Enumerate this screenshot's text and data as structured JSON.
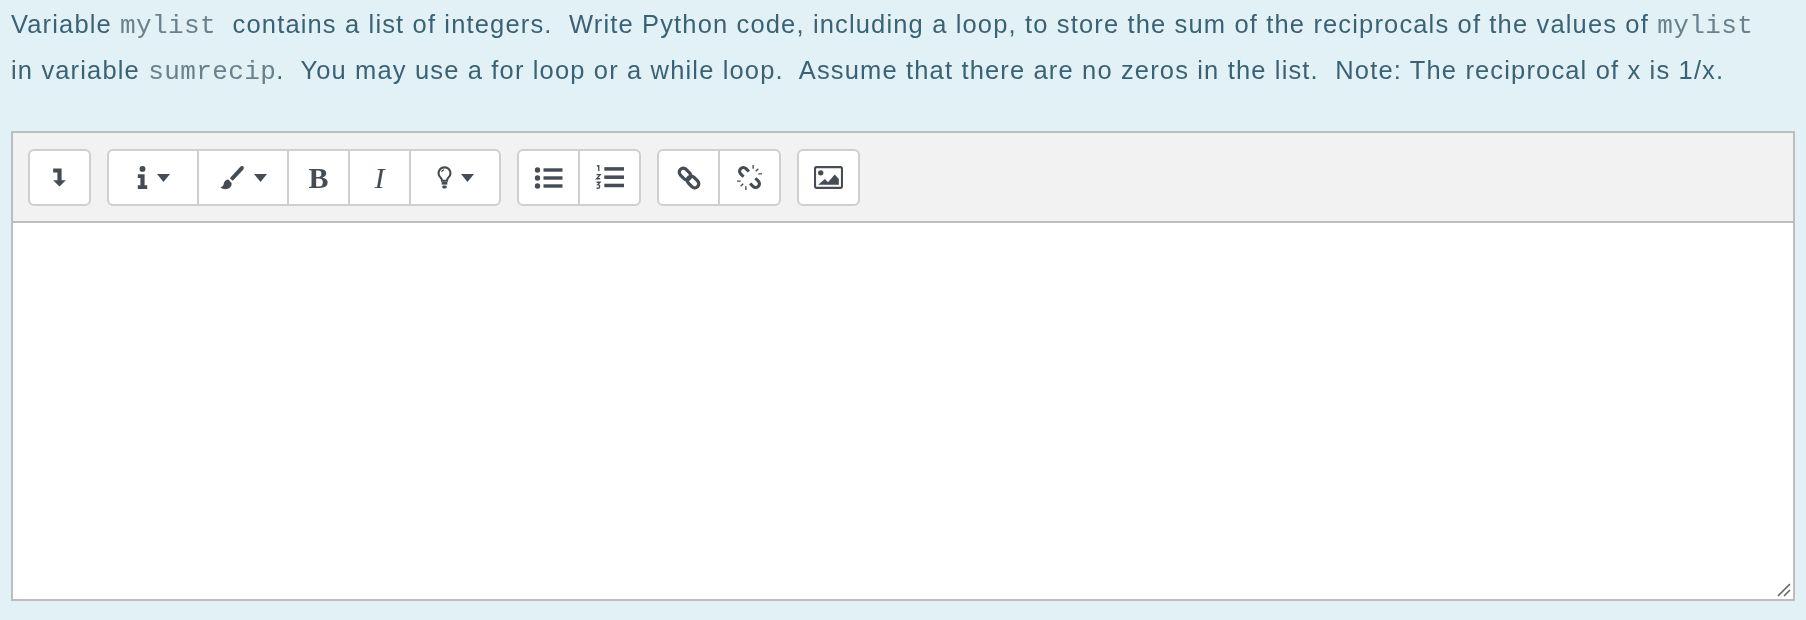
{
  "question": {
    "segments": [
      {
        "kind": "text",
        "text": "Variable "
      },
      {
        "kind": "code",
        "text": "mylist"
      },
      {
        "kind": "text",
        "text": "  contains a list of integers.  Write Python code, including a loop, to store the sum of the reciprocals of the values of "
      },
      {
        "kind": "code",
        "text": "mylist"
      },
      {
        "kind": "text",
        "text": " in variable "
      },
      {
        "kind": "code",
        "text": "sumrecip"
      },
      {
        "kind": "text",
        "text": ".  You may use a for loop or a while loop.  Assume that there are no zeros in the list.  Note: The reciprocal of x is 1/x."
      }
    ]
  },
  "editor": {
    "toolbar": {
      "groups": [
        {
          "buttons": [
            {
              "kind": "collapse",
              "dropdown": false
            }
          ]
        },
        {
          "buttons": [
            {
              "kind": "info",
              "dropdown": true
            },
            {
              "kind": "brush",
              "dropdown": true
            },
            {
              "kind": "bold",
              "label": "B",
              "dropdown": false
            },
            {
              "kind": "italic",
              "label": "I",
              "dropdown": false
            },
            {
              "kind": "lightbulb",
              "dropdown": true
            }
          ]
        },
        {
          "buttons": [
            {
              "kind": "bullets",
              "dropdown": false
            },
            {
              "kind": "numbers",
              "dropdown": false
            }
          ]
        },
        {
          "buttons": [
            {
              "kind": "link",
              "dropdown": false
            },
            {
              "kind": "unlink",
              "dropdown": false
            }
          ]
        },
        {
          "buttons": [
            {
              "kind": "image",
              "dropdown": false
            }
          ]
        }
      ]
    }
  }
}
